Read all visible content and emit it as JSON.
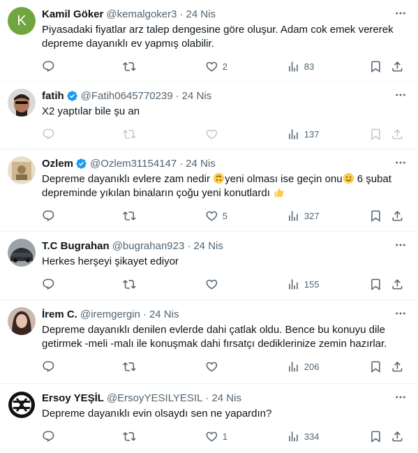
{
  "tweets": [
    {
      "name": "Kamil Göker",
      "handle": "@kemalgoker3",
      "separator": "·",
      "date": "24 Nis",
      "avatar_letter": "K",
      "text": "Piyasadaki fiyatlar arz talep dengesine göre oluşur. Adam cok emek vererek depreme dayanıklı ev yapmış olabilir.",
      "likes": "2",
      "views": "83"
    },
    {
      "name": "fatih",
      "handle": "@Fatih0645770239",
      "separator": "·",
      "date": "24 Nis",
      "text": "X2 yaptılar bile şu an",
      "likes": "",
      "views": "137"
    },
    {
      "name": "Ozlem",
      "handle": "@Ozlem31154147",
      "separator": "·",
      "date": "24 Nis",
      "text_part1": "Depreme dayanıklı evlere zam nedir ",
      "text_part2": "yeni olması ise geçin onu",
      "text_part3": " 6 şubat depreminde yıkılan binaların çoğu yeni konutlardı ",
      "likes": "5",
      "views": "327"
    },
    {
      "name": "T.C Bugrahan",
      "handle": "@bugrahan923",
      "separator": "·",
      "date": "24 Nis",
      "text": "Herkes herşeyi şikayet ediyor",
      "likes": "",
      "views": "155"
    },
    {
      "name": "İrem C.",
      "handle": "@iremgergin",
      "separator": "·",
      "date": "24 Nis",
      "text": "Depreme dayanıklı denilen evlerde dahi çatlak oldu. Bence bu konuyu dile getirmek -meli -malı ile konuşmak dahi fırsatçı dediklerinize zemin hazırlar.",
      "likes": "",
      "views": "206"
    },
    {
      "name": "Ersoy YEŞİL",
      "handle": "@ErsoyYESILYESIL",
      "separator": "·",
      "date": "24 Nis",
      "text": "Depreme dayanıklı evin olsaydı sen ne yapardın?",
      "likes": "1",
      "views": "334"
    }
  ],
  "colors": {
    "text": "#0f1419",
    "muted": "#536471",
    "verified": "#1d9bf0",
    "divider": "#eff3f4"
  },
  "icons": [
    "reply-icon",
    "retweet-icon",
    "like-icon",
    "views-icon",
    "bookmark-icon",
    "share-icon",
    "more-icon",
    "verified-icon"
  ]
}
